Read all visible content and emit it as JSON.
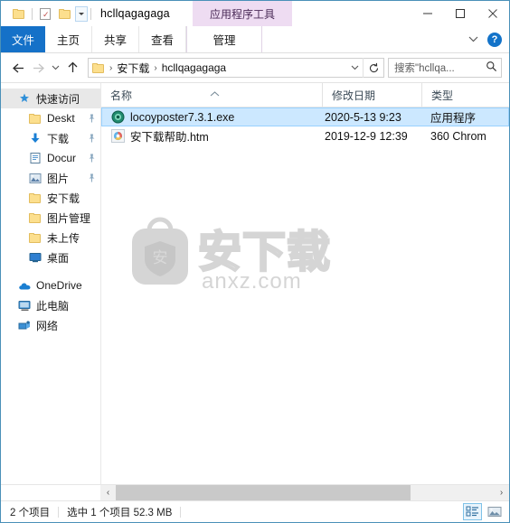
{
  "titlebar": {
    "quick_access": [
      {
        "name": "folder-icon",
        "label": "文件夹"
      },
      {
        "name": "properties-icon",
        "label": "属性"
      },
      {
        "name": "new-folder-icon",
        "label": "新建文件夹"
      }
    ],
    "title": "hcllqagagaga",
    "contextual_group": "应用程序工具",
    "minimize": "—",
    "maximize": "□",
    "close": "✕"
  },
  "ribbon": {
    "tabs": [
      {
        "label": "文件",
        "active": true
      },
      {
        "label": "主页",
        "active": false
      },
      {
        "label": "共享",
        "active": false
      },
      {
        "label": "查看",
        "active": false
      },
      {
        "label": "管理",
        "active": false,
        "contextual": true
      }
    ],
    "help_label": "?"
  },
  "address": {
    "back": "←",
    "forward": "→",
    "recent": "⌄",
    "up": "↑",
    "crumbs": [
      "安下载",
      "hcllqagagaga"
    ],
    "separator": "›",
    "dropdown": "⌄",
    "refresh": "↻"
  },
  "search": {
    "placeholder": "搜索\"hcllqa...",
    "icon": "search-icon"
  },
  "sidebar": {
    "items": [
      {
        "label": "快速访问",
        "icon": "star-pin-icon",
        "level": "root",
        "selected": true,
        "pinned": false
      },
      {
        "label": "Deskt",
        "icon": "folder-icon",
        "level": "child",
        "selected": false,
        "pinned": true
      },
      {
        "label": "下载",
        "icon": "download-arrow-icon",
        "level": "child",
        "selected": false,
        "pinned": true
      },
      {
        "label": "Docur",
        "icon": "documents-icon",
        "level": "child",
        "selected": false,
        "pinned": true
      },
      {
        "label": "图片",
        "icon": "pictures-icon",
        "level": "child",
        "selected": false,
        "pinned": true
      },
      {
        "label": "安下载",
        "icon": "folder-icon",
        "level": "child",
        "selected": false,
        "pinned": false
      },
      {
        "label": "图片管理",
        "icon": "folder-icon",
        "level": "child",
        "selected": false,
        "pinned": false
      },
      {
        "label": "未上传",
        "icon": "folder-icon",
        "level": "child",
        "selected": false,
        "pinned": false
      },
      {
        "label": "桌面",
        "icon": "desktop-icon",
        "level": "child",
        "selected": false,
        "pinned": false
      },
      {
        "label": "OneDrive",
        "icon": "cloud-icon",
        "level": "root",
        "selected": false,
        "pinned": false
      },
      {
        "label": "此电脑",
        "icon": "this-pc-icon",
        "level": "root",
        "selected": false,
        "pinned": false
      },
      {
        "label": "网络",
        "icon": "network-icon",
        "level": "root",
        "selected": false,
        "pinned": false
      }
    ]
  },
  "columns": {
    "name": "名称",
    "date": "修改日期",
    "type": "类型",
    "sort": "ascending"
  },
  "files": [
    {
      "name": "locoyposter7.3.1.exe",
      "date": "2020-5-13 9:23",
      "type": "应用程序",
      "icon": "exe-app-icon",
      "selected": true
    },
    {
      "name": "安下载帮助.htm",
      "date": "2019-12-9 12:39",
      "type": "360 Chrom",
      "icon": "browser-html-icon",
      "selected": false
    }
  ],
  "watermark": {
    "text": "安下载",
    "domain": "anxz.com",
    "badge": "安",
    "color": "#d5d5d5"
  },
  "statusbar": {
    "count": "2 个项目",
    "selection": "选中 1 个项目  52.3 MB",
    "views": [
      {
        "name": "details-view-button",
        "active": true
      },
      {
        "name": "large-icons-view-button",
        "active": false
      }
    ]
  },
  "colors": {
    "accent": "#1571c8",
    "selection": "#cce8ff",
    "contextual": "#eedcf2",
    "border": "#4a90b8"
  }
}
